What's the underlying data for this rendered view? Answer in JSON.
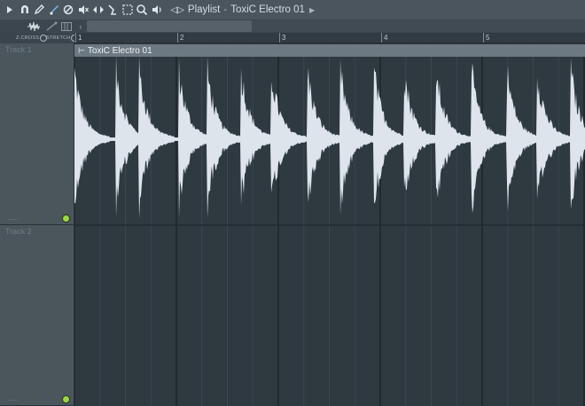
{
  "toolbar": {
    "icons": [
      "arrow-right-icon",
      "magnet-icon",
      "pencil-icon",
      "paint-brush-icon",
      "delete-icon",
      "mute-icon",
      "slip-icon",
      "slice-icon",
      "select-icon",
      "zoom-icon",
      "playback-icon"
    ],
    "title_prefix": "Playlist",
    "separator": "-",
    "title": "ToxiC Electro 01"
  },
  "row2": {
    "icons": [
      "audio-wave-icon",
      "stretch-tool-icon",
      "piano-icon"
    ]
  },
  "toggles": {
    "zcross": "Z-CROSS",
    "stretch": "STRETCH"
  },
  "ruler": {
    "bars": [
      "1",
      "2",
      "3",
      "4",
      "5"
    ]
  },
  "tracks": [
    {
      "name": "Track 1"
    },
    {
      "name": "Track 2"
    }
  ],
  "clip": {
    "name": "ToxiC Electro 01",
    "colors": {
      "waveform": "#dde4ec",
      "header": "#6d7982",
      "body": "#2f3940"
    }
  },
  "colors": {
    "accent_led": "#9ed84a",
    "toolbar_bg": "#4b555d"
  }
}
